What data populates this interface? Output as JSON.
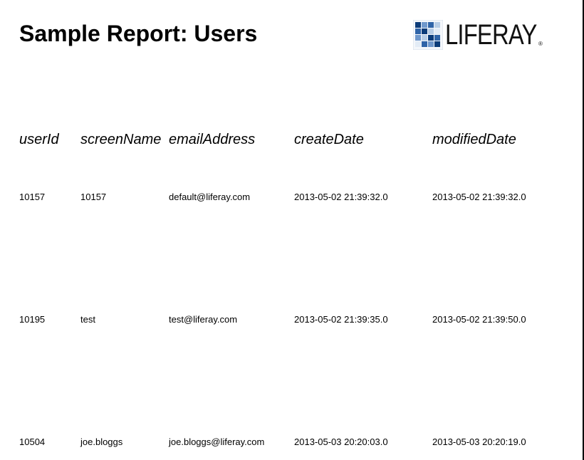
{
  "report": {
    "title": "Sample Report: Users"
  },
  "logo": {
    "name": "liferay-logo",
    "wordmark": "LIFERAY",
    "registered_mark": "®",
    "colors": [
      "#0b3c7a",
      "#2f64a8",
      "#6f98cc",
      "#b7cde6",
      "#e3ecf6"
    ]
  },
  "table": {
    "columns": [
      "userId",
      "screenName",
      "emailAddress",
      "createDate",
      "modifiedDate"
    ],
    "rows": [
      {
        "userId": "10157",
        "screenName": "10157",
        "emailAddress": "default@liferay.com",
        "createDate": "2013-05-02 21:39:32.0",
        "modifiedDate": "2013-05-02 21:39:32.0"
      },
      {
        "userId": "10195",
        "screenName": "test",
        "emailAddress": "test@liferay.com",
        "createDate": "2013-05-02 21:39:35.0",
        "modifiedDate": "2013-05-02 21:39:50.0"
      },
      {
        "userId": "10504",
        "screenName": "joe.bloggs",
        "emailAddress": "joe.bloggs@liferay.com",
        "createDate": "2013-05-03 20:20:03.0",
        "modifiedDate": "2013-05-03 20:20:19.0"
      }
    ]
  }
}
